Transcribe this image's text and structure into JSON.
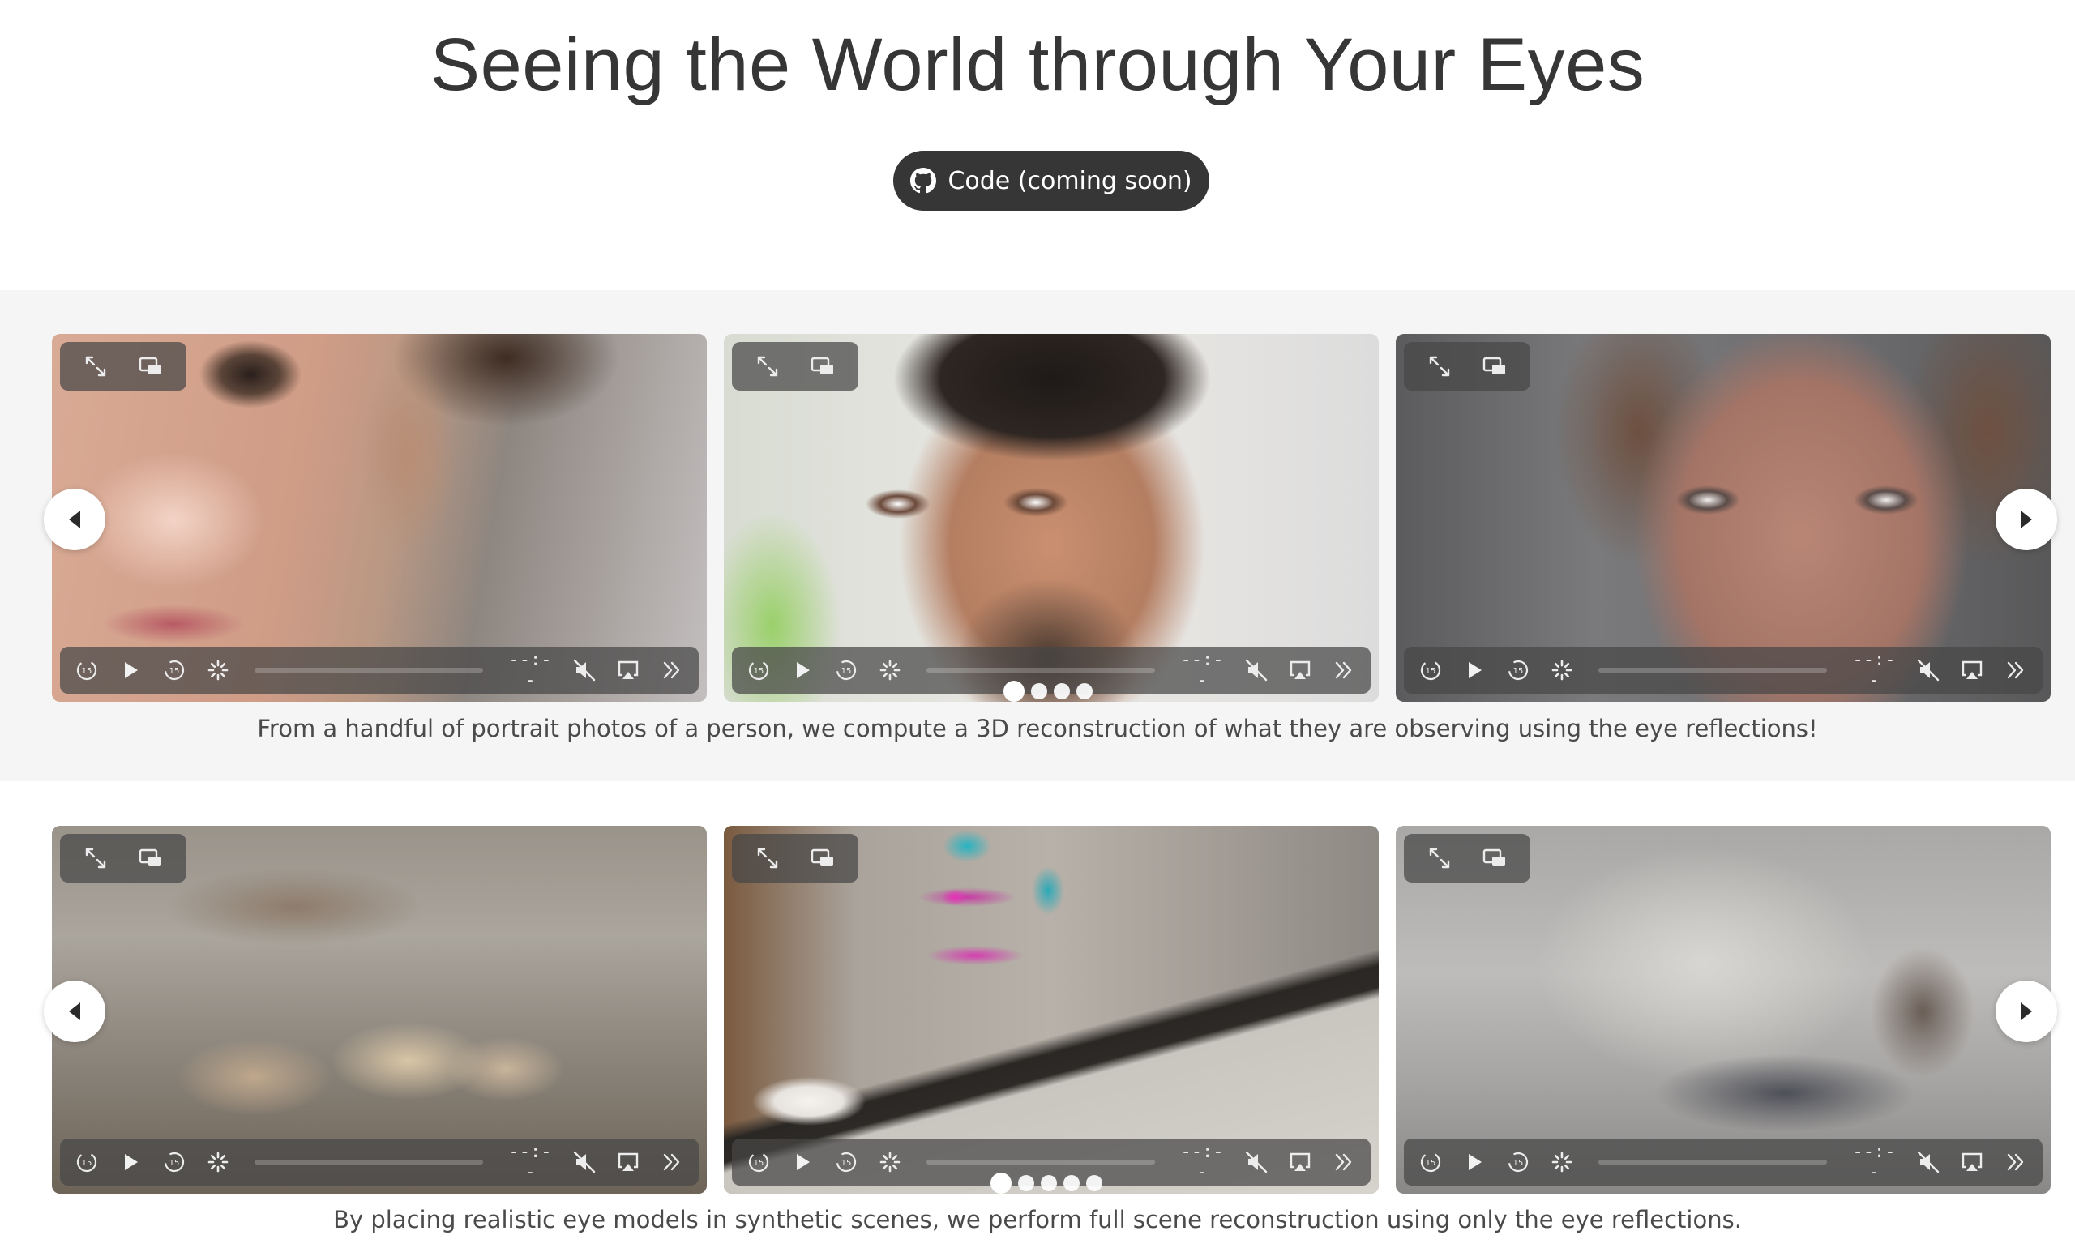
{
  "header": {
    "title": "Seeing the World through Your Eyes",
    "code_button_label": "Code (coming soon)"
  },
  "player": {
    "time_label": "--:--"
  },
  "carousels": [
    {
      "caption": "From a handful of portrait photos of a person, we compute a 3D reconstruction of what they are observing using the eye reflections!",
      "dot_count": 4,
      "active_dot": 1
    },
    {
      "caption": "By placing realistic eye models in synthetic scenes, we perform full scene reconstruction using only the eye reflections.",
      "dot_count": 5,
      "active_dot": 1
    }
  ],
  "icons": {
    "github": "github-icon",
    "fullscreen": "fullscreen-icon",
    "pip": "picture-in-picture-icon",
    "rewind": "rewind-15-icon",
    "play": "play-icon",
    "forward": "forward-15-icon",
    "loading": "loading-spinner-icon",
    "mute": "muted-speaker-icon",
    "airplay": "airplay-icon",
    "more": "double-chevron-icon",
    "prev": "chevron-left-icon",
    "next": "chevron-right-icon"
  },
  "colors": {
    "title": "#363636",
    "button_bg": "#363636",
    "band_bg": "#f5f5f5"
  }
}
